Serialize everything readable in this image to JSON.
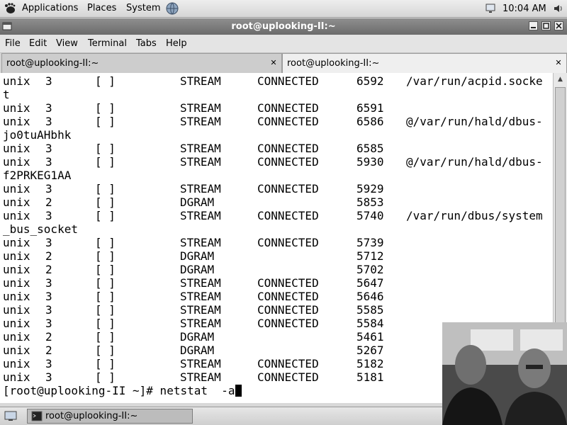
{
  "top_panel": {
    "menus": [
      "Applications",
      "Places",
      "System"
    ],
    "clock": "10:04 AM"
  },
  "window": {
    "title": "root@uplooking-II:~"
  },
  "menubar": [
    "File",
    "Edit",
    "View",
    "Terminal",
    "Tabs",
    "Help"
  ],
  "tabs": [
    {
      "label": "root@uplooking-II:~"
    },
    {
      "label": "root@uplooking-II:~"
    }
  ],
  "terminal": {
    "rows": [
      {
        "proto": "unix",
        "ref": "3",
        "flags": "[ ]",
        "type": "STREAM",
        "state": "CONNECTED",
        "inode": "6592",
        "path": "/var/run/acpid.socke"
      },
      {
        "wrap": "t"
      },
      {
        "proto": "unix",
        "ref": "3",
        "flags": "[ ]",
        "type": "STREAM",
        "state": "CONNECTED",
        "inode": "6591",
        "path": ""
      },
      {
        "proto": "unix",
        "ref": "3",
        "flags": "[ ]",
        "type": "STREAM",
        "state": "CONNECTED",
        "inode": "6586",
        "path": "@/var/run/hald/dbus-"
      },
      {
        "wrap": "jo0tuAHbhk"
      },
      {
        "proto": "unix",
        "ref": "3",
        "flags": "[ ]",
        "type": "STREAM",
        "state": "CONNECTED",
        "inode": "6585",
        "path": ""
      },
      {
        "proto": "unix",
        "ref": "3",
        "flags": "[ ]",
        "type": "STREAM",
        "state": "CONNECTED",
        "inode": "5930",
        "path": "@/var/run/hald/dbus-"
      },
      {
        "wrap": "f2PRKEG1AA"
      },
      {
        "proto": "unix",
        "ref": "3",
        "flags": "[ ]",
        "type": "STREAM",
        "state": "CONNECTED",
        "inode": "5929",
        "path": ""
      },
      {
        "proto": "unix",
        "ref": "2",
        "flags": "[ ]",
        "type": "DGRAM",
        "state": "",
        "inode": "5853",
        "path": ""
      },
      {
        "proto": "unix",
        "ref": "3",
        "flags": "[ ]",
        "type": "STREAM",
        "state": "CONNECTED",
        "inode": "5740",
        "path": "/var/run/dbus/system"
      },
      {
        "wrap": "_bus_socket"
      },
      {
        "proto": "unix",
        "ref": "3",
        "flags": "[ ]",
        "type": "STREAM",
        "state": "CONNECTED",
        "inode": "5739",
        "path": ""
      },
      {
        "proto": "unix",
        "ref": "2",
        "flags": "[ ]",
        "type": "DGRAM",
        "state": "",
        "inode": "5712",
        "path": ""
      },
      {
        "proto": "unix",
        "ref": "2",
        "flags": "[ ]",
        "type": "DGRAM",
        "state": "",
        "inode": "5702",
        "path": ""
      },
      {
        "proto": "unix",
        "ref": "3",
        "flags": "[ ]",
        "type": "STREAM",
        "state": "CONNECTED",
        "inode": "5647",
        "path": ""
      },
      {
        "proto": "unix",
        "ref": "3",
        "flags": "[ ]",
        "type": "STREAM",
        "state": "CONNECTED",
        "inode": "5646",
        "path": ""
      },
      {
        "proto": "unix",
        "ref": "3",
        "flags": "[ ]",
        "type": "STREAM",
        "state": "CONNECTED",
        "inode": "5585",
        "path": ""
      },
      {
        "proto": "unix",
        "ref": "3",
        "flags": "[ ]",
        "type": "STREAM",
        "state": "CONNECTED",
        "inode": "5584",
        "path": ""
      },
      {
        "proto": "unix",
        "ref": "2",
        "flags": "[ ]",
        "type": "DGRAM",
        "state": "",
        "inode": "5461",
        "path": ""
      },
      {
        "proto": "unix",
        "ref": "2",
        "flags": "[ ]",
        "type": "DGRAM",
        "state": "",
        "inode": "5267",
        "path": ""
      },
      {
        "proto": "unix",
        "ref": "3",
        "flags": "[ ]",
        "type": "STREAM",
        "state": "CONNECTED",
        "inode": "5182",
        "path": ""
      },
      {
        "proto": "unix",
        "ref": "3",
        "flags": "[ ]",
        "type": "STREAM",
        "state": "CONNECTED",
        "inode": "5181",
        "path": ""
      }
    ],
    "prompt": "[root@uplooking-II ~]# netstat  -a"
  },
  "taskbar": {
    "window_button": "root@uplooking-II:~"
  },
  "icons": {
    "distro_logo": "gnome-foot-icon",
    "system_icon": "globe-icon",
    "window_menu": "window-menu-icon",
    "minimize": "minimize-icon",
    "maximize": "maximize-icon",
    "close": "close-icon",
    "monitor": "monitor-icon",
    "terminal": "terminal-icon",
    "trash": "trash-icon"
  },
  "colors": {
    "terminal_bg": "#ffffff",
    "terminal_fg": "#000000",
    "titlebar": "#7b7b7b"
  }
}
